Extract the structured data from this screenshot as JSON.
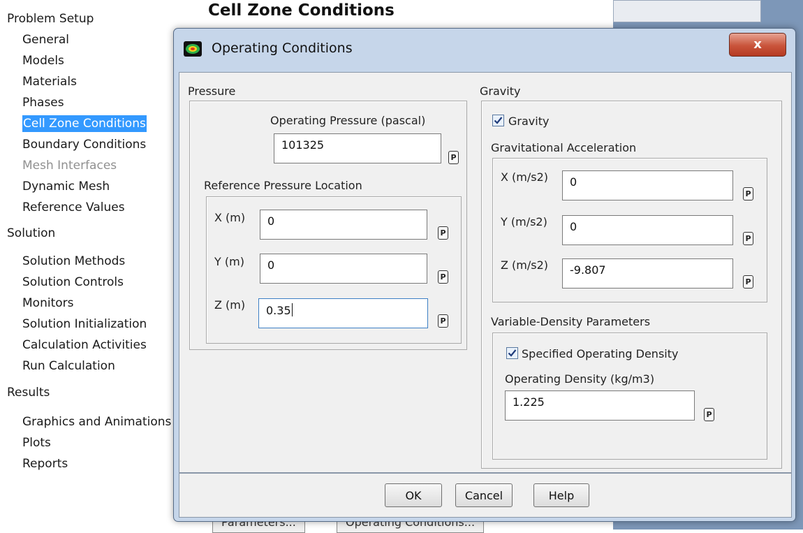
{
  "nav": {
    "sections": [
      {
        "title": "Problem Setup",
        "items": [
          "General",
          "Models",
          "Materials",
          "Phases",
          "Cell Zone Conditions",
          "Boundary Conditions",
          "Mesh Interfaces",
          "Dynamic Mesh",
          "Reference Values"
        ]
      },
      {
        "title": "Solution",
        "items": [
          "Solution Methods",
          "Solution Controls",
          "Monitors",
          "Solution Initialization",
          "Calculation Activities",
          "Run Calculation"
        ]
      },
      {
        "title": "Results",
        "items": [
          "Graphics and Animations",
          "Plots",
          "Reports"
        ]
      }
    ],
    "selected_item": "Cell Zone Conditions",
    "disabled_item": "Mesh Interfaces"
  },
  "panel": {
    "title": "Cell Zone Conditions",
    "bottom_buttons": [
      "Parameters...",
      "Operating Conditions..."
    ]
  },
  "dialog": {
    "title": "Operating Conditions",
    "close_symbol": "x",
    "pressure": {
      "group_label": "Pressure",
      "operating_pressure_label": "Operating Pressure (pascal)",
      "operating_pressure_value": "101325",
      "reference_location_label": "Reference Pressure Location",
      "x_label": "X (m)",
      "x_value": "0",
      "y_label": "Y (m)",
      "y_value": "0",
      "z_label": "Z (m)",
      "z_value": "0.35"
    },
    "gravity": {
      "group_label": "Gravity",
      "checkbox_label": "Gravity",
      "checkbox_checked": true,
      "acceleration_label": "Gravitational Acceleration",
      "x_label": "X (m/s2)",
      "x_value": "0",
      "y_label": "Y (m/s2)",
      "y_value": "0",
      "z_label": "Z (m/s2)",
      "z_value": "-9.807"
    },
    "density": {
      "group_label": "Variable-Density Parameters",
      "checkbox_label": "Specified Operating Density",
      "checkbox_checked": true,
      "density_label": "Operating Density (kg/m3)",
      "density_value": "1.225"
    },
    "param_button_label": "P",
    "buttons": {
      "ok": "OK",
      "cancel": "Cancel",
      "help": "Help"
    }
  },
  "colors": {
    "selection": "#3399ff",
    "dialog_frame": "#c6d6ea",
    "close_button": "#c9543b",
    "client_background": "#f0f0f0"
  }
}
